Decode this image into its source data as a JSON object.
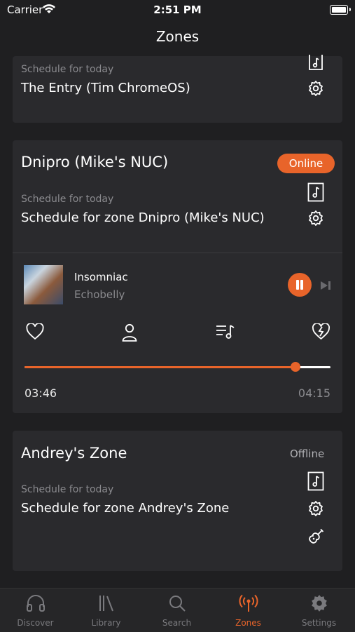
{
  "status_bar": {
    "carrier": "Carrier",
    "time": "2:51 PM"
  },
  "nav": {
    "title": "Zones"
  },
  "cards": [
    {
      "schedule_label": "Schedule for today",
      "schedule_name": "The Entry (Tim ChromeOS)"
    },
    {
      "zone_name": "Dnipro (Mike's NUC)",
      "status": "Online",
      "schedule_label": "Schedule for today",
      "schedule_name": "Schedule for zone Dnipro (Mike's NUC)",
      "player": {
        "track": "Insomniac",
        "artist": "Echobelly",
        "elapsed": "03:46",
        "duration": "04:15",
        "progress": 0.885
      }
    },
    {
      "zone_name": "Andrey's Zone",
      "status": "Offline",
      "schedule_label": "Schedule for today",
      "schedule_name": "Schedule for zone Andrey's Zone"
    }
  ],
  "tabs": [
    {
      "label": "Discover",
      "icon": "headphones-icon"
    },
    {
      "label": "Library",
      "icon": "library-icon"
    },
    {
      "label": "Search",
      "icon": "search-icon"
    },
    {
      "label": "Zones",
      "icon": "broadcast-icon",
      "active": true
    },
    {
      "label": "Settings",
      "icon": "gear-icon"
    }
  ],
  "colors": {
    "accent": "#e8642a",
    "background": "#1f1f21",
    "card": "#2a2a2d"
  }
}
